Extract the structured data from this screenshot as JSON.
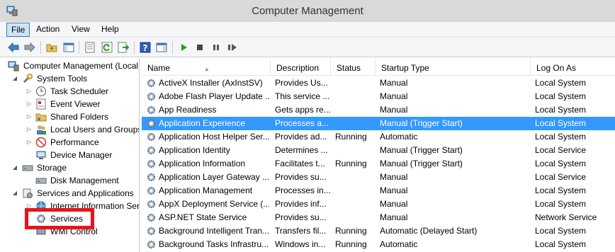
{
  "window": {
    "title": "Computer Management"
  },
  "menu": [
    "File",
    "Action",
    "View",
    "Help"
  ],
  "toolbar_icons": [
    "back-arrow-icon",
    "forward-arrow-icon",
    "up-folder-icon",
    "show-hide-tree-icon",
    "properties-icon",
    "refresh-icon",
    "export-list-icon",
    "help-icon",
    "show-hide-action-pane-icon",
    "start-service-icon",
    "stop-service-icon",
    "pause-service-icon",
    "restart-service-icon"
  ],
  "tree": [
    {
      "label": "Computer Management (Local",
      "icon": "computer-management-icon",
      "arrow": "",
      "level": 0
    },
    {
      "label": "System Tools",
      "icon": "system-tools-icon",
      "arrow": "◢",
      "level": 1
    },
    {
      "label": "Task Scheduler",
      "icon": "clock-icon",
      "arrow": "▷",
      "level": 2
    },
    {
      "label": "Event Viewer",
      "icon": "event-viewer-icon",
      "arrow": "▷",
      "level": 2
    },
    {
      "label": "Shared Folders",
      "icon": "shared-folder-icon",
      "arrow": "▷",
      "level": 2
    },
    {
      "label": "Local Users and Groups",
      "icon": "users-icon",
      "arrow": "▷",
      "level": 2
    },
    {
      "label": "Performance",
      "icon": "performance-icon",
      "arrow": "▷",
      "level": 2
    },
    {
      "label": "Device Manager",
      "icon": "device-manager-icon",
      "arrow": "",
      "level": 2
    },
    {
      "label": "Storage",
      "icon": "storage-icon",
      "arrow": "◢",
      "level": 1
    },
    {
      "label": "Disk Management",
      "icon": "disk-icon",
      "arrow": "",
      "level": 2
    },
    {
      "label": "Services and Applications",
      "icon": "services-apps-icon",
      "arrow": "◢",
      "level": 1
    },
    {
      "label": "Internet Information Ser",
      "icon": "iis-icon",
      "arrow": "▷",
      "level": 2
    },
    {
      "label": "Services",
      "icon": "services-gear-icon",
      "arrow": "",
      "level": 2
    },
    {
      "label": "WMI Control",
      "icon": "wmi-icon",
      "arrow": "",
      "level": 2
    }
  ],
  "columns": [
    "Name",
    "Description",
    "Status",
    "Startup Type",
    "Log On As"
  ],
  "rows": [
    {
      "name": "ActiveX Installer (AxInstSV)",
      "description": "Provides Us...",
      "status": "",
      "startup": "Manual",
      "logon": "Local System",
      "selected": false
    },
    {
      "name": "Adobe Flash Player Update ...",
      "description": "This service ...",
      "status": "",
      "startup": "Manual",
      "logon": "Local System",
      "selected": false
    },
    {
      "name": "App Readiness",
      "description": "Gets apps re...",
      "status": "",
      "startup": "Manual",
      "logon": "Local System",
      "selected": false
    },
    {
      "name": "Application Experience",
      "description": "Processes a...",
      "status": "",
      "startup": "Manual (Trigger Start)",
      "logon": "Local System",
      "selected": true
    },
    {
      "name": "Application Host Helper Ser...",
      "description": "Provides ad...",
      "status": "Running",
      "startup": "Automatic",
      "logon": "Local System",
      "selected": false
    },
    {
      "name": "Application Identity",
      "description": "Determines ...",
      "status": "",
      "startup": "Manual (Trigger Start)",
      "logon": "Local Service",
      "selected": false
    },
    {
      "name": "Application Information",
      "description": "Facilitates t...",
      "status": "Running",
      "startup": "Manual (Trigger Start)",
      "logon": "Local System",
      "selected": false
    },
    {
      "name": "Application Layer Gateway ...",
      "description": "Provides su...",
      "status": "",
      "startup": "Manual",
      "logon": "Local Service",
      "selected": false
    },
    {
      "name": "Application Management",
      "description": "Processes in...",
      "status": "",
      "startup": "Manual",
      "logon": "Local System",
      "selected": false
    },
    {
      "name": "AppX Deployment Service (...",
      "description": "Provides inf...",
      "status": "",
      "startup": "Manual",
      "logon": "Local System",
      "selected": false
    },
    {
      "name": "ASP.NET State Service",
      "description": "Provides su...",
      "status": "",
      "startup": "Manual",
      "logon": "Network Service",
      "selected": false
    },
    {
      "name": "Background Intelligent Tran...",
      "description": "Transfers fil...",
      "status": "Running",
      "startup": "Automatic (Delayed Start)",
      "logon": "Local System",
      "selected": false
    },
    {
      "name": "Background Tasks Infrastru...",
      "description": "Windows in...",
      "status": "Running",
      "startup": "Automatic",
      "logon": "Local System",
      "selected": false
    }
  ],
  "colors": {
    "selection": "#3399ff",
    "highlight_box": "#e8141b",
    "titlebar": "#d9d9d9"
  }
}
